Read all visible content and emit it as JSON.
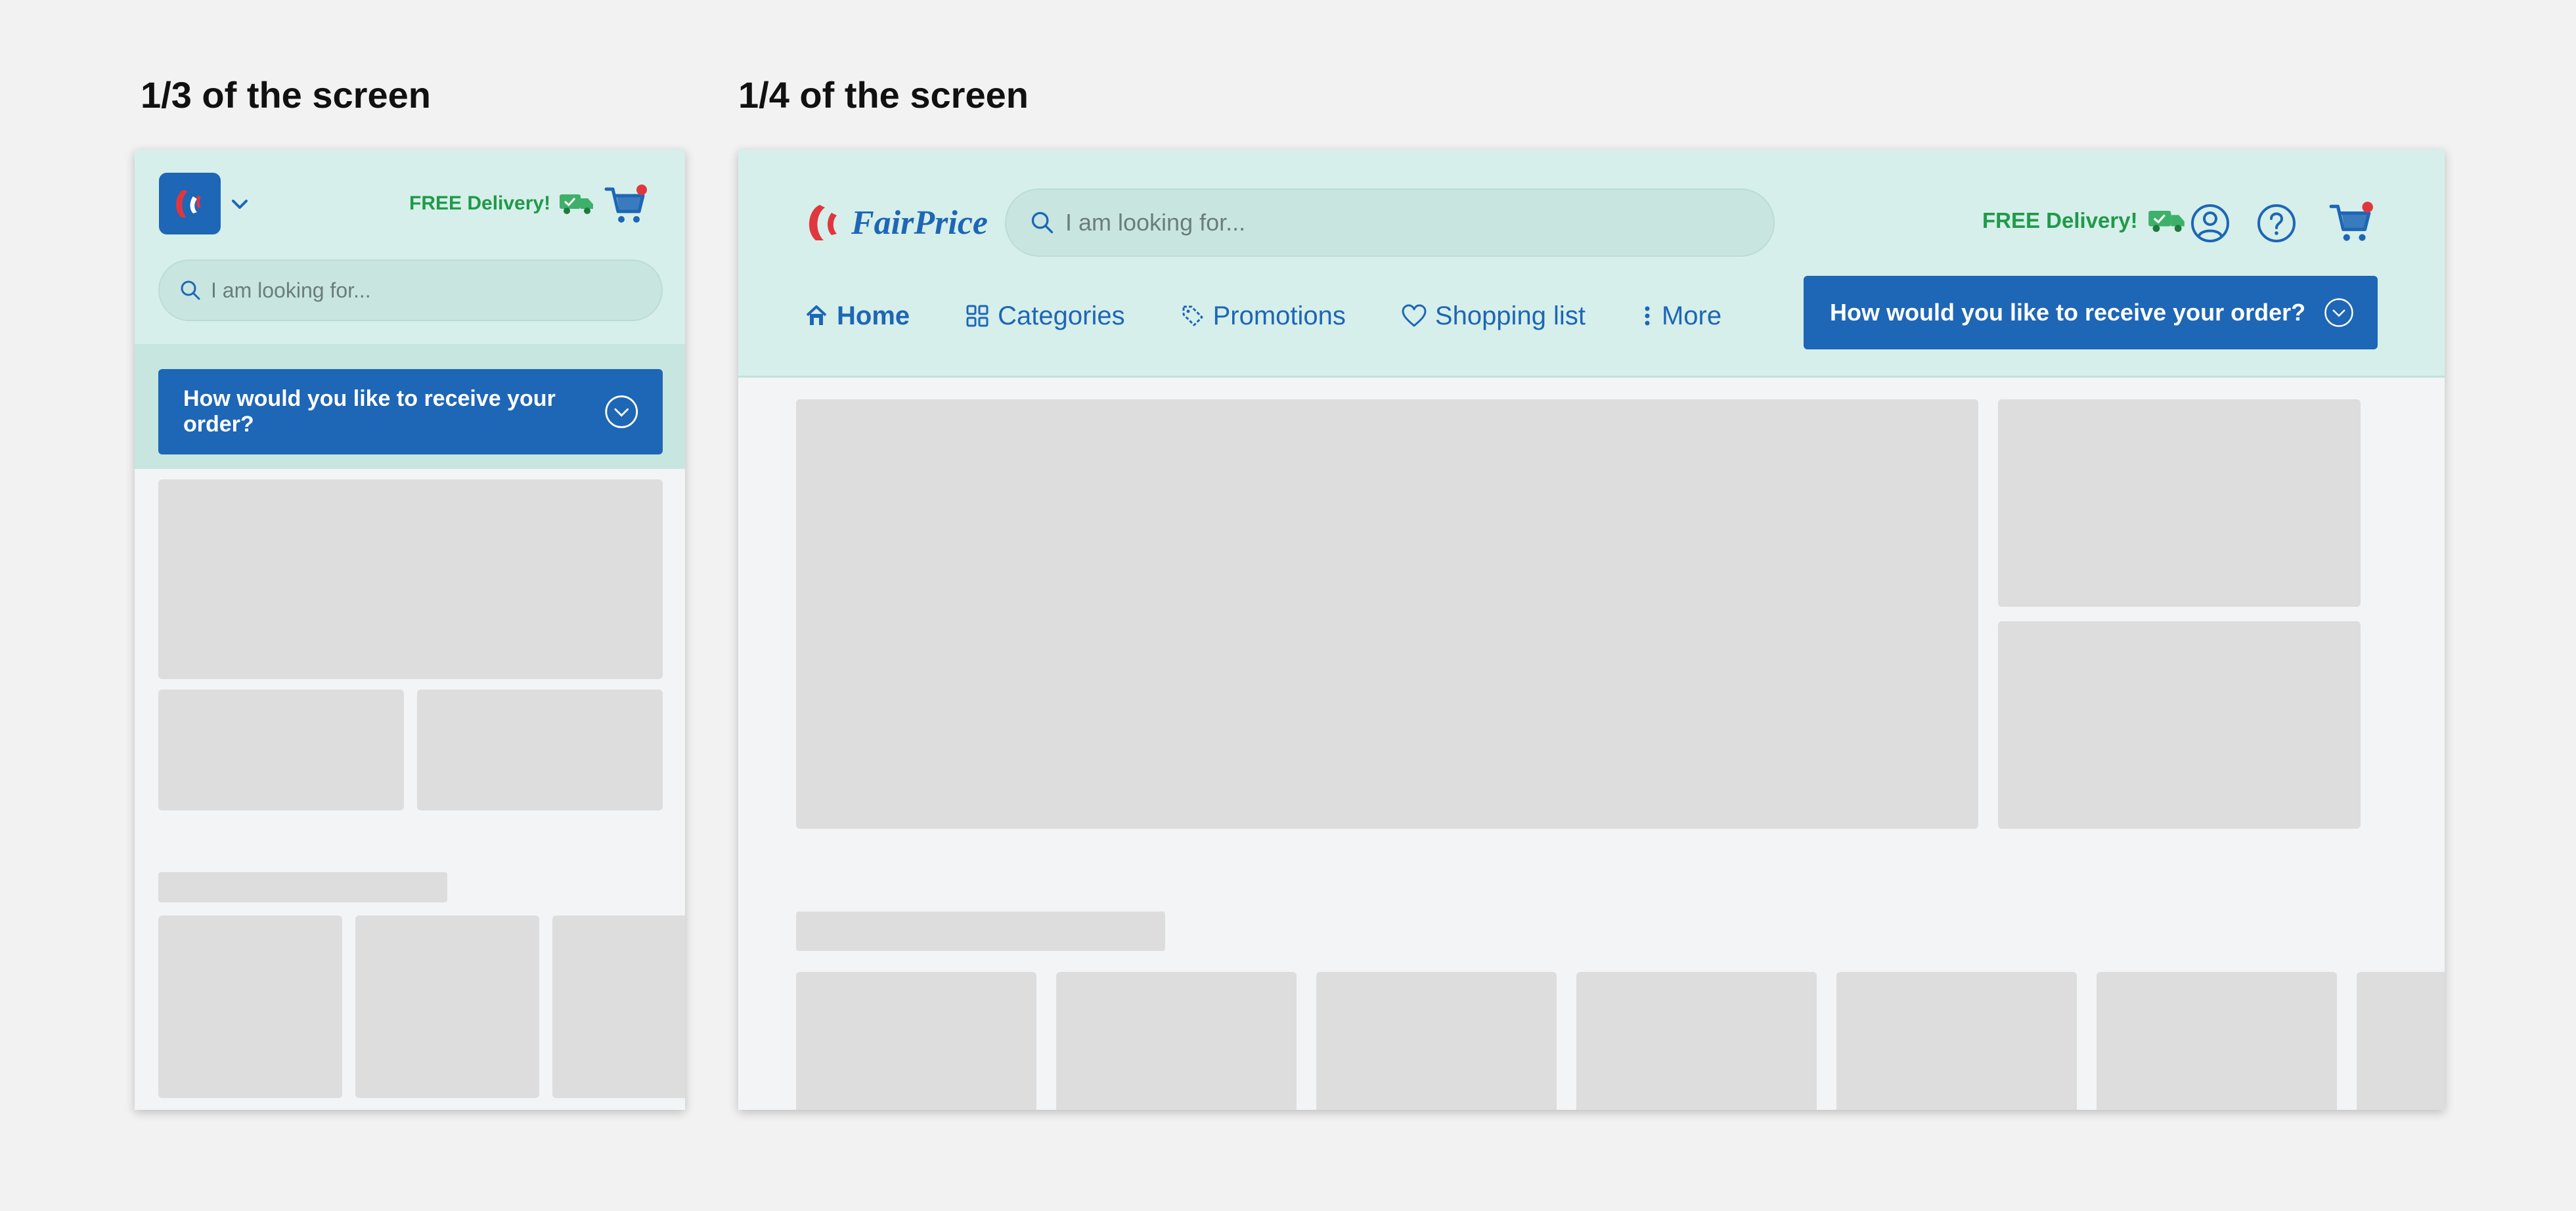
{
  "headings": {
    "left": "1/3 of the screen",
    "right": "1/4 of the screen"
  },
  "brand": {
    "name": "FairPrice",
    "primary_color": "#1e66b6",
    "header_bg": "#d6efea",
    "accent_red": "#e0373f",
    "delivery_green": "#1f9a4a"
  },
  "header": {
    "free_delivery": "FREE Delivery!",
    "search_placeholder": "I am looking for...",
    "order_prompt": "How would you like to receive your order?"
  },
  "nav": {
    "items": [
      {
        "label": "Home",
        "icon": "home-icon",
        "active": true
      },
      {
        "label": "Categories",
        "icon": "grid-icon",
        "active": false
      },
      {
        "label": "Promotions",
        "icon": "tag-icon",
        "active": false
      },
      {
        "label": "Shopping list",
        "icon": "heart-icon",
        "active": false
      },
      {
        "label": "More",
        "icon": "more-vertical-icon",
        "active": false
      }
    ]
  },
  "icons": [
    "chevron-down-icon",
    "truck-icon",
    "cart-icon",
    "user-icon",
    "help-icon",
    "search-icon"
  ]
}
